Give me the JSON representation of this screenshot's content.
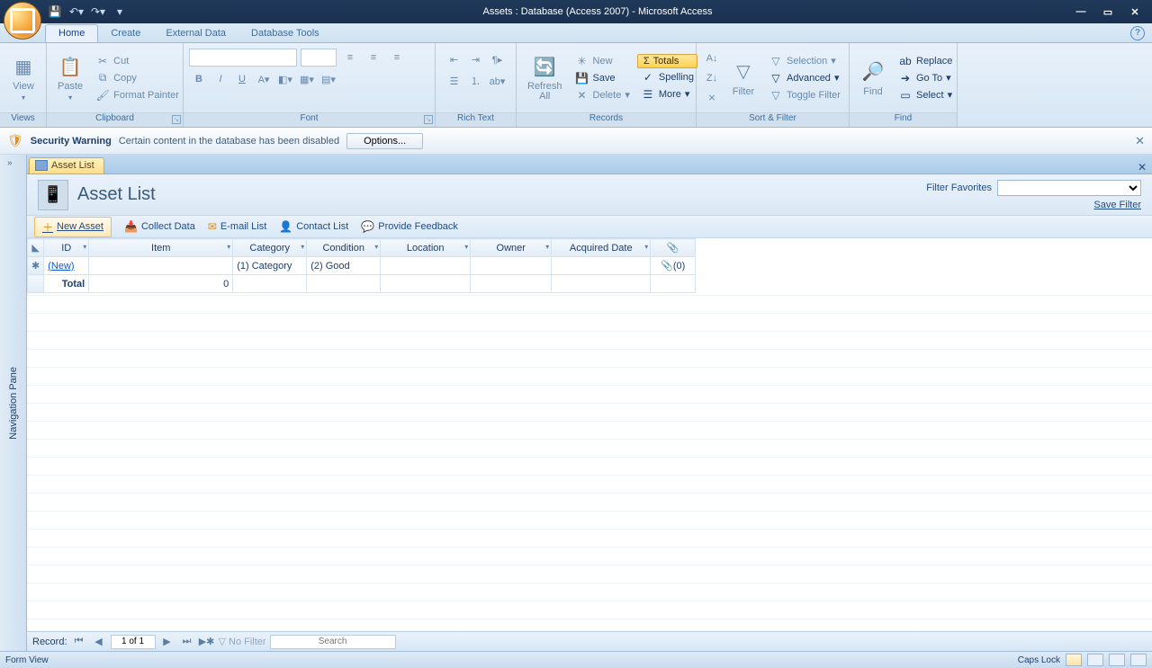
{
  "title": "Assets : Database (Access 2007) - Microsoft Access",
  "tabs": {
    "home": "Home",
    "create": "Create",
    "externaldata": "External Data",
    "dbtools": "Database Tools"
  },
  "ribbon": {
    "views": {
      "view": "View",
      "label": "Views"
    },
    "clipboard": {
      "paste": "Paste",
      "cut": "Cut",
      "copy": "Copy",
      "formatpainter": "Format Painter",
      "label": "Clipboard"
    },
    "font": {
      "label": "Font"
    },
    "richtext": {
      "label": "Rich Text"
    },
    "records": {
      "refresh": "Refresh All",
      "new": "New",
      "save": "Save",
      "delete": "Delete",
      "totals": "Totals",
      "spelling": "Spelling",
      "more": "More",
      "label": "Records"
    },
    "sortfilter": {
      "filter": "Filter",
      "selection": "Selection",
      "advanced": "Advanced",
      "toggle": "Toggle Filter",
      "label": "Sort & Filter"
    },
    "find": {
      "find": "Find",
      "replace": "Replace",
      "goto": "Go To",
      "select": "Select",
      "label": "Find"
    }
  },
  "security": {
    "warning": "Security Warning",
    "msg": "Certain content in the database has been disabled",
    "options": "Options..."
  },
  "navpane": "Navigation Pane",
  "doctab": "Asset List",
  "form": {
    "title": "Asset List",
    "filterfav": "Filter Favorites",
    "savefilter": "Save Filter",
    "toolbar": {
      "newasset": "New Asset",
      "collect": "Collect Data",
      "email": "E-mail List",
      "contact": "Contact List",
      "feedback": "Provide Feedback"
    }
  },
  "columns": [
    "ID",
    "Item",
    "Category",
    "Condition",
    "Location",
    "Owner",
    "Acquired Date",
    "📎"
  ],
  "row": {
    "id": "(New)",
    "item": "",
    "category": "(1) Category",
    "condition": "(2) Good",
    "location": "",
    "owner": "",
    "acquired": "",
    "attach": "📎(0)"
  },
  "total": {
    "label": "Total",
    "value": "0"
  },
  "recordnav": {
    "label": "Record:",
    "pos": "1 of 1",
    "nofilter": "No Filter",
    "search": "Search"
  },
  "status": {
    "left": "Form View",
    "caps": "Caps Lock"
  }
}
